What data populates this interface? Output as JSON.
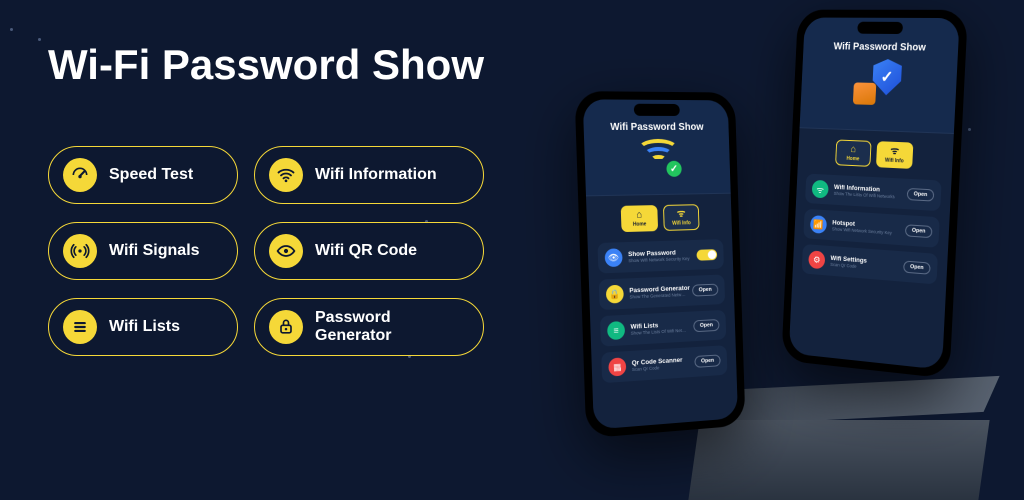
{
  "heading": "Wi-Fi Password Show",
  "features": [
    {
      "label": "Speed Test",
      "icon": "gauge"
    },
    {
      "label": "Wifi Information",
      "icon": "wifi"
    },
    {
      "label": "Wifi Signals",
      "icon": "signal"
    },
    {
      "label": "Wifi QR Code",
      "icon": "eye"
    },
    {
      "label": "Wifi Lists",
      "icon": "list"
    },
    {
      "label": "Password Generator",
      "icon": "lock"
    }
  ],
  "phone1": {
    "title": "Wifi Password Show",
    "tabs": {
      "home": "Home",
      "wifiinfo": "Wifi Info"
    },
    "rows": [
      {
        "title": "Show Password",
        "sub": "Show Wifi Network Security Key",
        "action": "toggle",
        "color": "blue"
      },
      {
        "title": "Password Generator",
        "sub": "Show The Generated Network Pw",
        "action": "Open",
        "color": "yellow"
      },
      {
        "title": "Wifi Lists",
        "sub": "Show The Lists Of Wifi Network",
        "action": "Open",
        "color": "green"
      },
      {
        "title": "Qr Code Scanner",
        "sub": "Scan Qr Code",
        "action": "Open",
        "color": "red"
      }
    ]
  },
  "phone2": {
    "title": "Wifi Password Show",
    "tabs": {
      "home": "Home",
      "wifiinfo": "Wifi Info"
    },
    "rows": [
      {
        "title": "Wifi Information",
        "sub": "Show The Lists Of Wifi Networks",
        "action": "Open",
        "color": "green"
      },
      {
        "title": "Hotspot",
        "sub": "Show Wifi Network Security Key",
        "action": "Open",
        "color": "blue"
      },
      {
        "title": "Wifi Settings",
        "sub": "Scan Qr Code",
        "action": "Open",
        "color": "red"
      }
    ]
  }
}
